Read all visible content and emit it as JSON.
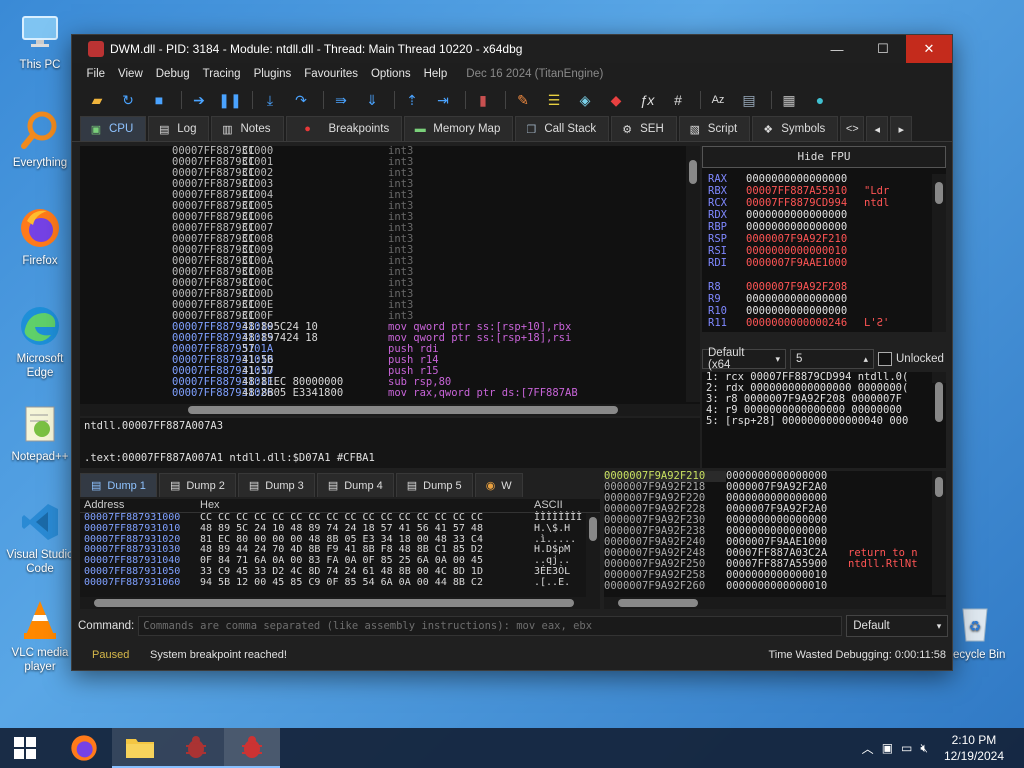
{
  "desktop": {
    "icons": [
      {
        "label": "This PC",
        "icon": "monitor-icon"
      },
      {
        "label": "Everything",
        "icon": "magnifier-icon"
      },
      {
        "label": "Firefox",
        "icon": "firefox-icon"
      },
      {
        "label": "Microsoft Edge",
        "icon": "edge-icon"
      },
      {
        "label": "Notepad++",
        "icon": "notepadpp-icon"
      },
      {
        "label": "Visual Studio Code",
        "icon": "vscode-icon"
      },
      {
        "label": "VLC media player",
        "icon": "vlc-icon"
      },
      {
        "label": "Recycle Bin",
        "icon": "recycle-bin-icon"
      }
    ]
  },
  "window": {
    "title": "DWM.dll - PID: 3184 - Module: ntdll.dll - Thread: Main Thread 10220 - x64dbg",
    "minimize": "—",
    "maximize": "☐",
    "close": "✕"
  },
  "menu": {
    "items": [
      "File",
      "View",
      "Debug",
      "Tracing",
      "Plugins",
      "Favourites",
      "Options",
      "Help"
    ],
    "date": "Dec 16 2024 (TitanEngine)"
  },
  "toolbar": {
    "icons": [
      "open-icon",
      "restart-icon",
      "stop-icon",
      "run-icon",
      "pause-icon",
      "step-into-icon",
      "step-over-icon",
      "trace-into-icon",
      "trace-over-icon",
      "execute-till-return-icon",
      "run-to-user-code-icon",
      "scylla-icon",
      "patch-icon",
      "comment-icon",
      "label-icon",
      "bookmark-icon",
      "function-icon",
      "hash-icon",
      "font-icon",
      "clipboard-icon",
      "calculator-icon",
      "globe-icon"
    ]
  },
  "tabs": [
    {
      "label": "CPU",
      "icon": "cpu-icon",
      "active": true
    },
    {
      "label": "Log",
      "icon": "log-icon"
    },
    {
      "label": "Notes",
      "icon": "notes-icon"
    },
    {
      "label": "Breakpoints",
      "icon": "breakpoint-icon"
    },
    {
      "label": "Memory Map",
      "icon": "memory-icon"
    },
    {
      "label": "Call Stack",
      "icon": "callstack-icon"
    },
    {
      "label": "SEH",
      "icon": "seh-icon"
    },
    {
      "label": "Script",
      "icon": "script-icon"
    },
    {
      "label": "Symbols",
      "icon": "symbols-icon"
    }
  ],
  "disasm": {
    "rows": [
      {
        "addr": "00007FF887931000",
        "bytes": "CC",
        "ins": "int3"
      },
      {
        "addr": "00007FF887931001",
        "bytes": "CC",
        "ins": "int3"
      },
      {
        "addr": "00007FF887931002",
        "bytes": "CC",
        "ins": "int3"
      },
      {
        "addr": "00007FF887931003",
        "bytes": "CC",
        "ins": "int3"
      },
      {
        "addr": "00007FF887931004",
        "bytes": "CC",
        "ins": "int3"
      },
      {
        "addr": "00007FF887931005",
        "bytes": "CC",
        "ins": "int3"
      },
      {
        "addr": "00007FF887931006",
        "bytes": "CC",
        "ins": "int3"
      },
      {
        "addr": "00007FF887931007",
        "bytes": "CC",
        "ins": "int3"
      },
      {
        "addr": "00007FF887931008",
        "bytes": "CC",
        "ins": "int3"
      },
      {
        "addr": "00007FF887931009",
        "bytes": "CC",
        "ins": "int3"
      },
      {
        "addr": "00007FF88793100A",
        "bytes": "CC",
        "ins": "int3"
      },
      {
        "addr": "00007FF88793100B",
        "bytes": "CC",
        "ins": "int3"
      },
      {
        "addr": "00007FF88793100C",
        "bytes": "CC",
        "ins": "int3"
      },
      {
        "addr": "00007FF88793100D",
        "bytes": "CC",
        "ins": "int3"
      },
      {
        "addr": "00007FF88793100E",
        "bytes": "CC",
        "ins": "int3"
      },
      {
        "addr": "00007FF88793100F",
        "bytes": "CC",
        "ins": "int3"
      },
      {
        "addr": "00007FF887931010",
        "bytes": "48:895C24 10",
        "ins": "mov qword ptr ss:[rsp+10],rbx"
      },
      {
        "addr": "00007FF887931015",
        "bytes": "48:897424 18",
        "ins": "mov qword ptr ss:[rsp+18],rsi"
      },
      {
        "addr": "00007FF88793101A",
        "bytes": "57",
        "ins": "push rdi"
      },
      {
        "addr": "00007FF88793101B",
        "bytes": "41:56",
        "ins": "push r14"
      },
      {
        "addr": "00007FF88793101D",
        "bytes": "41:57",
        "ins": "push r15"
      },
      {
        "addr": "00007FF88793101F",
        "bytes": "48:81EC 80000000",
        "ins": "sub rsp,80"
      },
      {
        "addr": "00007FF887931026",
        "bytes": "48:8B05 E3341800",
        "ins": "mov rax,qword ptr ds:[7FF887AB"
      }
    ]
  },
  "info": {
    "line1": "ntdll.00007FF887A007A3",
    "line2": "",
    "line3": ".text:00007FF887A007A1 ntdll.dll:$D07A1 #CFBA1"
  },
  "registers": {
    "hide_fpu": "Hide FPU",
    "rows": [
      {
        "name": "RAX",
        "value": "0000000000000000",
        "comment": ""
      },
      {
        "name": "RBX",
        "value": "00007FF887A55910",
        "comment": "\"Ldr"
      },
      {
        "name": "RCX",
        "value": "00007FF8879CD994",
        "comment": "ntdl"
      },
      {
        "name": "RDX",
        "value": "0000000000000000",
        "comment": ""
      },
      {
        "name": "RBP",
        "value": "0000000000000000",
        "comment": ""
      },
      {
        "name": "RSP",
        "value": "0000007F9A92F210",
        "comment": ""
      },
      {
        "name": "RSI",
        "value": "0000000000000010",
        "comment": ""
      },
      {
        "name": "RDI",
        "value": "0000007F9AAE1000",
        "comment": ""
      },
      {
        "name": "",
        "value": "",
        "comment": ""
      },
      {
        "name": "R8",
        "value": "0000007F9A92F208",
        "comment": ""
      },
      {
        "name": "R9",
        "value": "0000000000000000",
        "comment": ""
      },
      {
        "name": "R10",
        "value": "0000000000000000",
        "comment": ""
      },
      {
        "name": "R11",
        "value": "0000000000000246",
        "comment": "L'Ƨ'"
      }
    ]
  },
  "callconv": {
    "selected": "Default (x64",
    "count": "5",
    "unlocked": "Unlocked"
  },
  "args": [
    "1: rcx 00007FF8879CD994 ntdll.0(",
    "2: rdx 0000000000000000 0000000(",
    "3: r8 0000007F9A92F208 0000007F",
    "4: r9 0000000000000000 00000000",
    "5: [rsp+28] 0000000000000040 000"
  ],
  "dump_tabs": [
    {
      "label": "Dump 1",
      "active": true
    },
    {
      "label": "Dump 2"
    },
    {
      "label": "Dump 3"
    },
    {
      "label": "Dump 4"
    },
    {
      "label": "Dump 5"
    },
    {
      "label": "W"
    }
  ],
  "dump": {
    "headers": [
      "Address",
      "Hex",
      "ASCII"
    ],
    "rows": [
      {
        "addr": "00007FF887931000",
        "hex": "CC CC CC CC  CC CC CC CC  CC CC CC CC  CC CC CC CC",
        "ascii": "ÌÌÌÌÌÌÌÌ"
      },
      {
        "addr": "00007FF887931010",
        "hex": "48 89 5C 24  10 48 89 74  24 18 57 41  56 41 57 48",
        "ascii": "H.\\$.H"
      },
      {
        "addr": "00007FF887931020",
        "hex": "81 EC 80 00  00 00 48 8B  05 E3 34 18  00 48 33 C4",
        "ascii": ".ì....."
      },
      {
        "addr": "00007FF887931030",
        "hex": "48 89 44 24  70 4D 8B F9  41 8B F8 48  8B C1 85 D2",
        "ascii": "H.D$pM"
      },
      {
        "addr": "00007FF887931040",
        "hex": "0F 84 71 6A  0A 00 83 FA  0A 0F 85 25  6A 0A 00 45",
        "ascii": "..qj.."
      },
      {
        "addr": "00007FF887931050",
        "hex": "33 C9 45 33  D2 4C 8D 74  24 61 48 8B  00 4C 8D 1D",
        "ascii": "3ÉE3ÒL"
      },
      {
        "addr": "00007FF887931060",
        "hex": "94 5B 12 00  45 85 C9 0F  85 54 6A 0A  00 44 8B C2",
        "ascii": ".[..E."
      }
    ]
  },
  "stack": {
    "rows": [
      {
        "addr": "0000007F9A92F210",
        "value": "0000000000000000",
        "comment": ""
      },
      {
        "addr": "0000007F9A92F218",
        "value": "0000007F9A92F2A0",
        "comment": ""
      },
      {
        "addr": "0000007F9A92F220",
        "value": "0000000000000000",
        "comment": ""
      },
      {
        "addr": "0000007F9A92F228",
        "value": "0000007F9A92F2A0",
        "comment": ""
      },
      {
        "addr": "0000007F9A92F230",
        "value": "0000000000000000",
        "comment": ""
      },
      {
        "addr": "0000007F9A92F238",
        "value": "0000000000000000",
        "comment": ""
      },
      {
        "addr": "0000007F9A92F240",
        "value": "0000007F9AAE1000",
        "comment": ""
      },
      {
        "addr": "0000007F9A92F248",
        "value": "00007FF887A03C2A",
        "comment": "return to n"
      },
      {
        "addr": "0000007F9A92F250",
        "value": "00007FF887A55900",
        "comment": "ntdll.RtlNt"
      },
      {
        "addr": "0000007F9A92F258",
        "value": "0000000000000010",
        "comment": ""
      },
      {
        "addr": "0000007F9A92F260",
        "value": "0000000000000010",
        "comment": ""
      }
    ]
  },
  "command": {
    "label": "Command:",
    "placeholder": "Commands are comma separated (like assembly instructions): mov eax, ebx",
    "mode": "Default"
  },
  "status": {
    "state": "Paused",
    "message": "System breakpoint reached!",
    "time": "Time Wasted Debugging: 0:00:11:58"
  },
  "taskbar": {
    "time": "2:10 PM",
    "date": "12/19/2024"
  }
}
